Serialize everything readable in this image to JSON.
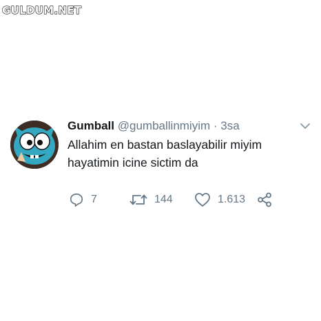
{
  "watermark": "GULDUM.NET",
  "tweet": {
    "author_name": "Gumball",
    "handle": "@gumballinmiyim",
    "separator": "·",
    "time": "3sa",
    "text_lines": [
      "Allahim en bastan baslayabilir miyim",
      "hayatimin icine sictim da"
    ],
    "reply_count": "7",
    "retweet_count": "144",
    "like_count": "1.613"
  },
  "icons": {
    "reply": "reply-icon",
    "retweet": "retweet-icon",
    "like": "heart-icon",
    "share": "share-icon",
    "menu": "chevron-down-icon"
  },
  "colors": {
    "text": "#14171a",
    "muted": "#657786",
    "avatar_teal": "#34a8c0"
  }
}
